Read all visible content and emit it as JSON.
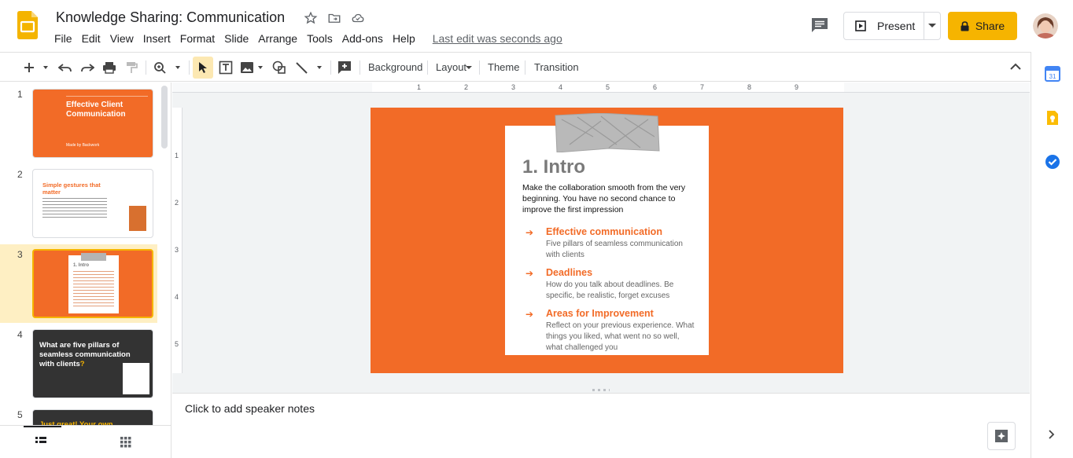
{
  "header": {
    "title": "Knowledge Sharing: Communication",
    "menu": [
      "File",
      "Edit",
      "View",
      "Insert",
      "Format",
      "Slide",
      "Arrange",
      "Tools",
      "Add-ons",
      "Help"
    ],
    "last_edit": "Last edit was seconds ago",
    "present_label": "Present",
    "share_label": "Share",
    "share_color": "#f6b400"
  },
  "toolbar": {
    "background": "Background",
    "layout": "Layout",
    "theme": "Theme",
    "transition": "Transition"
  },
  "filmstrip": {
    "slides": [
      {
        "num": "1",
        "title": "Effective Client Communication",
        "subtitle": "Made by Backwork"
      },
      {
        "num": "2",
        "title": "Simple gestures that matter"
      },
      {
        "num": "3",
        "title": "1. Intro"
      },
      {
        "num": "4",
        "title_a": "What are five pillars of seamless communication with clients",
        "title_q": "?"
      },
      {
        "num": "5",
        "title_a": "Just great! Your own"
      }
    ]
  },
  "ruler": {
    "h": [
      "1",
      "2",
      "3",
      "4",
      "5",
      "6",
      "7",
      "8",
      "9"
    ],
    "v": [
      "1",
      "2",
      "3",
      "4",
      "5"
    ]
  },
  "slide": {
    "accent": "#f26b27",
    "title": "1. Intro",
    "intro": "Make the collaboration smooth from the very beginning. You have no second chance to improve the first impression",
    "bullets": [
      {
        "arrow": "➔",
        "title": "Effective communication",
        "text": "Five pillars of seamless communication with clients"
      },
      {
        "arrow": "➔",
        "title": "Deadlines",
        "text": "How do you talk about deadlines. Be specific, be realistic, forget excuses"
      },
      {
        "arrow": "➔",
        "title": "Areas for Improvement",
        "text": "Reflect on your previous experience. What things you liked, what went no so well, what challenged you"
      }
    ]
  },
  "notes": {
    "placeholder": "Click to add speaker notes"
  }
}
